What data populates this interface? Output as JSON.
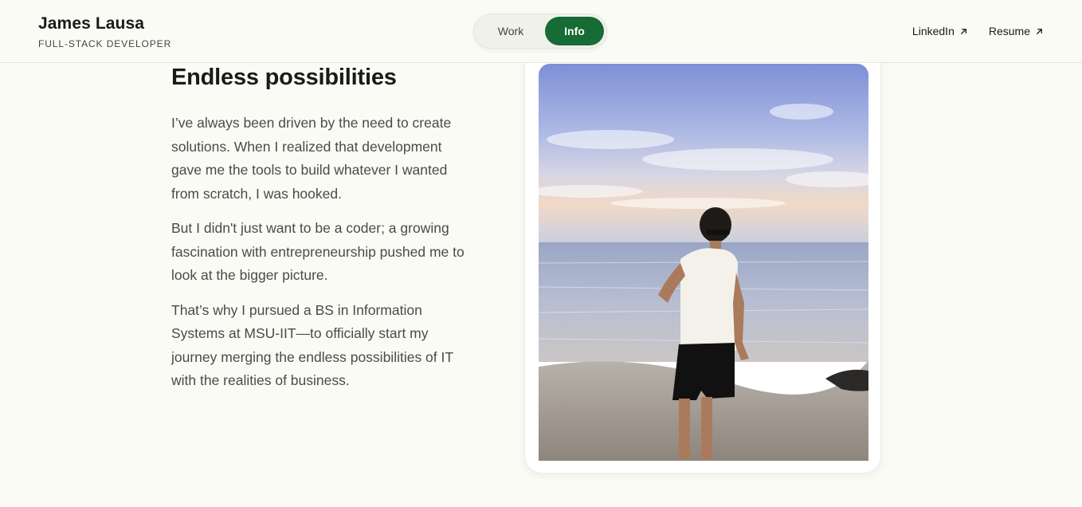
{
  "header": {
    "name": "James Lausa",
    "role": "FULL-STACK DEVELOPER"
  },
  "toggle": {
    "work_label": "Work",
    "info_label": "Info",
    "active": "Info",
    "active_color": "#176b35"
  },
  "nav": {
    "links": [
      {
        "label": "LinkedIn",
        "icon": "external-arrow-icon"
      },
      {
        "label": "Resume",
        "icon": "external-arrow-icon"
      }
    ]
  },
  "main": {
    "heading": "Endless possibilities",
    "paragraphs": [
      "I’ve always been driven by the need to create solutions. When I realized that development gave me the tools to build whatever I wanted from scratch, I was hooked.",
      "But I didn't just want to be a coder; a growing fascination with entrepreneurship pushed me to look at the bigger picture.",
      "That’s why I pursued a BS in Information Systems at MSU-IIT—to officially start my journey merging the endless possibilities of IT with the realities of business."
    ]
  },
  "colors": {
    "background": "#fbfbf5",
    "accent": "#176b35"
  }
}
